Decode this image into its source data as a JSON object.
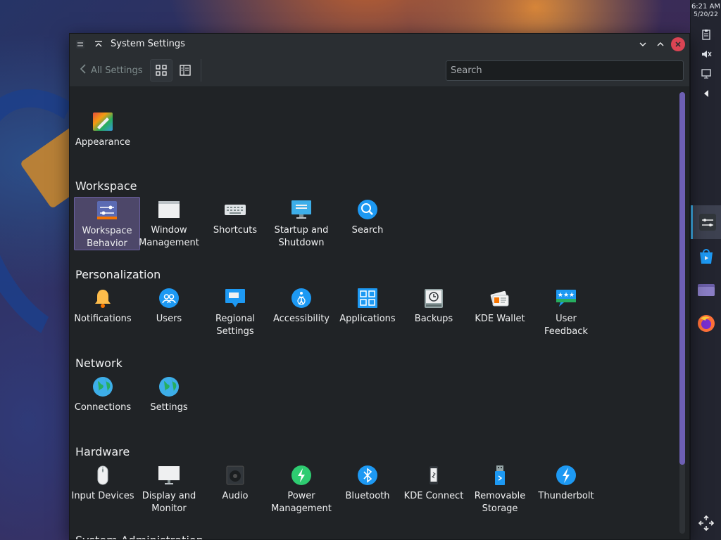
{
  "clock": {
    "time": "6:21 AM",
    "date": "5/20/22"
  },
  "window": {
    "title": "System Settings"
  },
  "toolbar": {
    "back_label": "All Settings",
    "search_placeholder": "Search"
  },
  "top": [
    {
      "label": "Appearance",
      "icon": "appearance-icon"
    }
  ],
  "sections": {
    "workspace": {
      "title": "Workspace",
      "items": [
        "Workspace Behavior",
        "Window Management",
        "Shortcuts",
        "Startup and Shutdown",
        "Search"
      ]
    },
    "personalization": {
      "title": "Personalization",
      "items": [
        "Notifications",
        "Users",
        "Regional Settings",
        "Accessibility",
        "Applications",
        "Backups",
        "KDE Wallet",
        "User Feedback"
      ]
    },
    "network": {
      "title": "Network",
      "items": [
        "Connections",
        "Settings"
      ]
    },
    "hardware": {
      "title": "Hardware",
      "items": [
        "Input Devices",
        "Display and Monitor",
        "Audio",
        "Power Management",
        "Bluetooth",
        "KDE Connect",
        "Removable Storage",
        "Thunderbolt"
      ]
    },
    "sysadmin": {
      "title": "System Administration"
    }
  },
  "colors": {
    "accent": "#3daee9",
    "selection": "#4d4769",
    "close": "#da4453"
  }
}
